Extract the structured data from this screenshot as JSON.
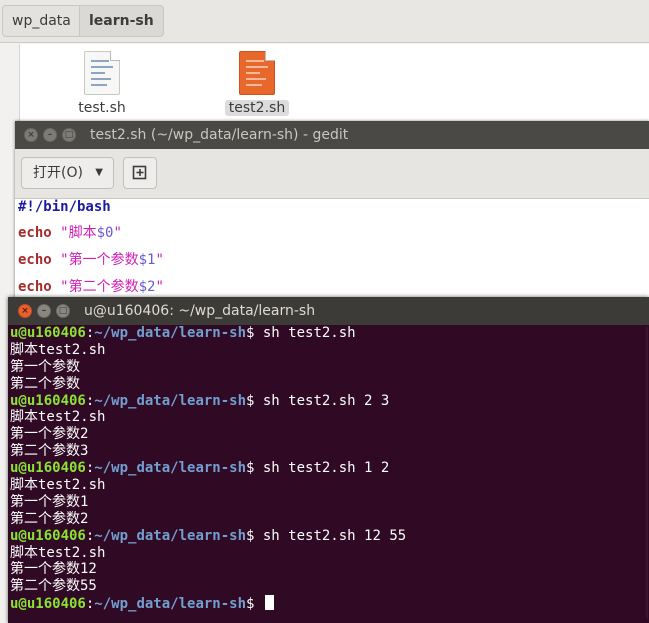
{
  "file_manager": {
    "breadcrumbs": [
      "wp_data",
      "learn-sh"
    ],
    "files": [
      {
        "name": "test.sh",
        "icon": "shell-script-file-icon",
        "selected": false
      },
      {
        "name": "test2.sh",
        "icon": "shell-script-file-icon",
        "selected": true
      }
    ]
  },
  "gedit": {
    "title": "test2.sh (~/wp_data/learn-sh) - gedit",
    "open_button": "打开(O)",
    "new_button_icon": "new-document-icon",
    "code": [
      {
        "type": "shebang",
        "text": "#!/bin/bash"
      },
      {
        "type": "echo",
        "kw": "echo",
        "q1": "\"",
        "str": "脚本",
        "var": "$0",
        "q2": "\""
      },
      {
        "type": "echo",
        "kw": "echo",
        "q1": "\"",
        "str": "第一个参数",
        "var": "$1",
        "q2": "\""
      },
      {
        "type": "echo",
        "kw": "echo",
        "q1": "\"",
        "str": "第二个参数",
        "var": "$2",
        "q2": "\""
      }
    ]
  },
  "terminal": {
    "title": "u@u160406: ~/wp_data/learn-sh",
    "prompt": {
      "user": "u@u160406",
      "sep": ":",
      "path": "~/wp_data/learn-sh",
      "sym": "$"
    },
    "lines": [
      {
        "type": "prompt",
        "cmd": " sh test2.sh"
      },
      {
        "type": "out",
        "text": "脚本test2.sh"
      },
      {
        "type": "out",
        "text": "第一个参数"
      },
      {
        "type": "out",
        "text": "第二个参数"
      },
      {
        "type": "prompt",
        "cmd": " sh test2.sh 2 3"
      },
      {
        "type": "out",
        "text": "脚本test2.sh"
      },
      {
        "type": "out",
        "text": "第一个参数2"
      },
      {
        "type": "out",
        "text": "第二个参数3"
      },
      {
        "type": "prompt",
        "cmd": " sh test2.sh 1 2"
      },
      {
        "type": "out",
        "text": "脚本test2.sh"
      },
      {
        "type": "out",
        "text": "第一个参数1"
      },
      {
        "type": "out",
        "text": "第二个参数2"
      },
      {
        "type": "prompt",
        "cmd": " sh test2.sh 12 55"
      },
      {
        "type": "out",
        "text": "脚本test2.sh"
      },
      {
        "type": "out",
        "text": "第一个参数12"
      },
      {
        "type": "out",
        "text": "第二个参数55"
      },
      {
        "type": "prompt",
        "cmd": " ",
        "cursor": true
      }
    ]
  },
  "colors": {
    "terminal_bg": "#300a24",
    "prompt_user": "#8ae234",
    "prompt_path": "#729fcf",
    "close_button": "#e9602f"
  }
}
